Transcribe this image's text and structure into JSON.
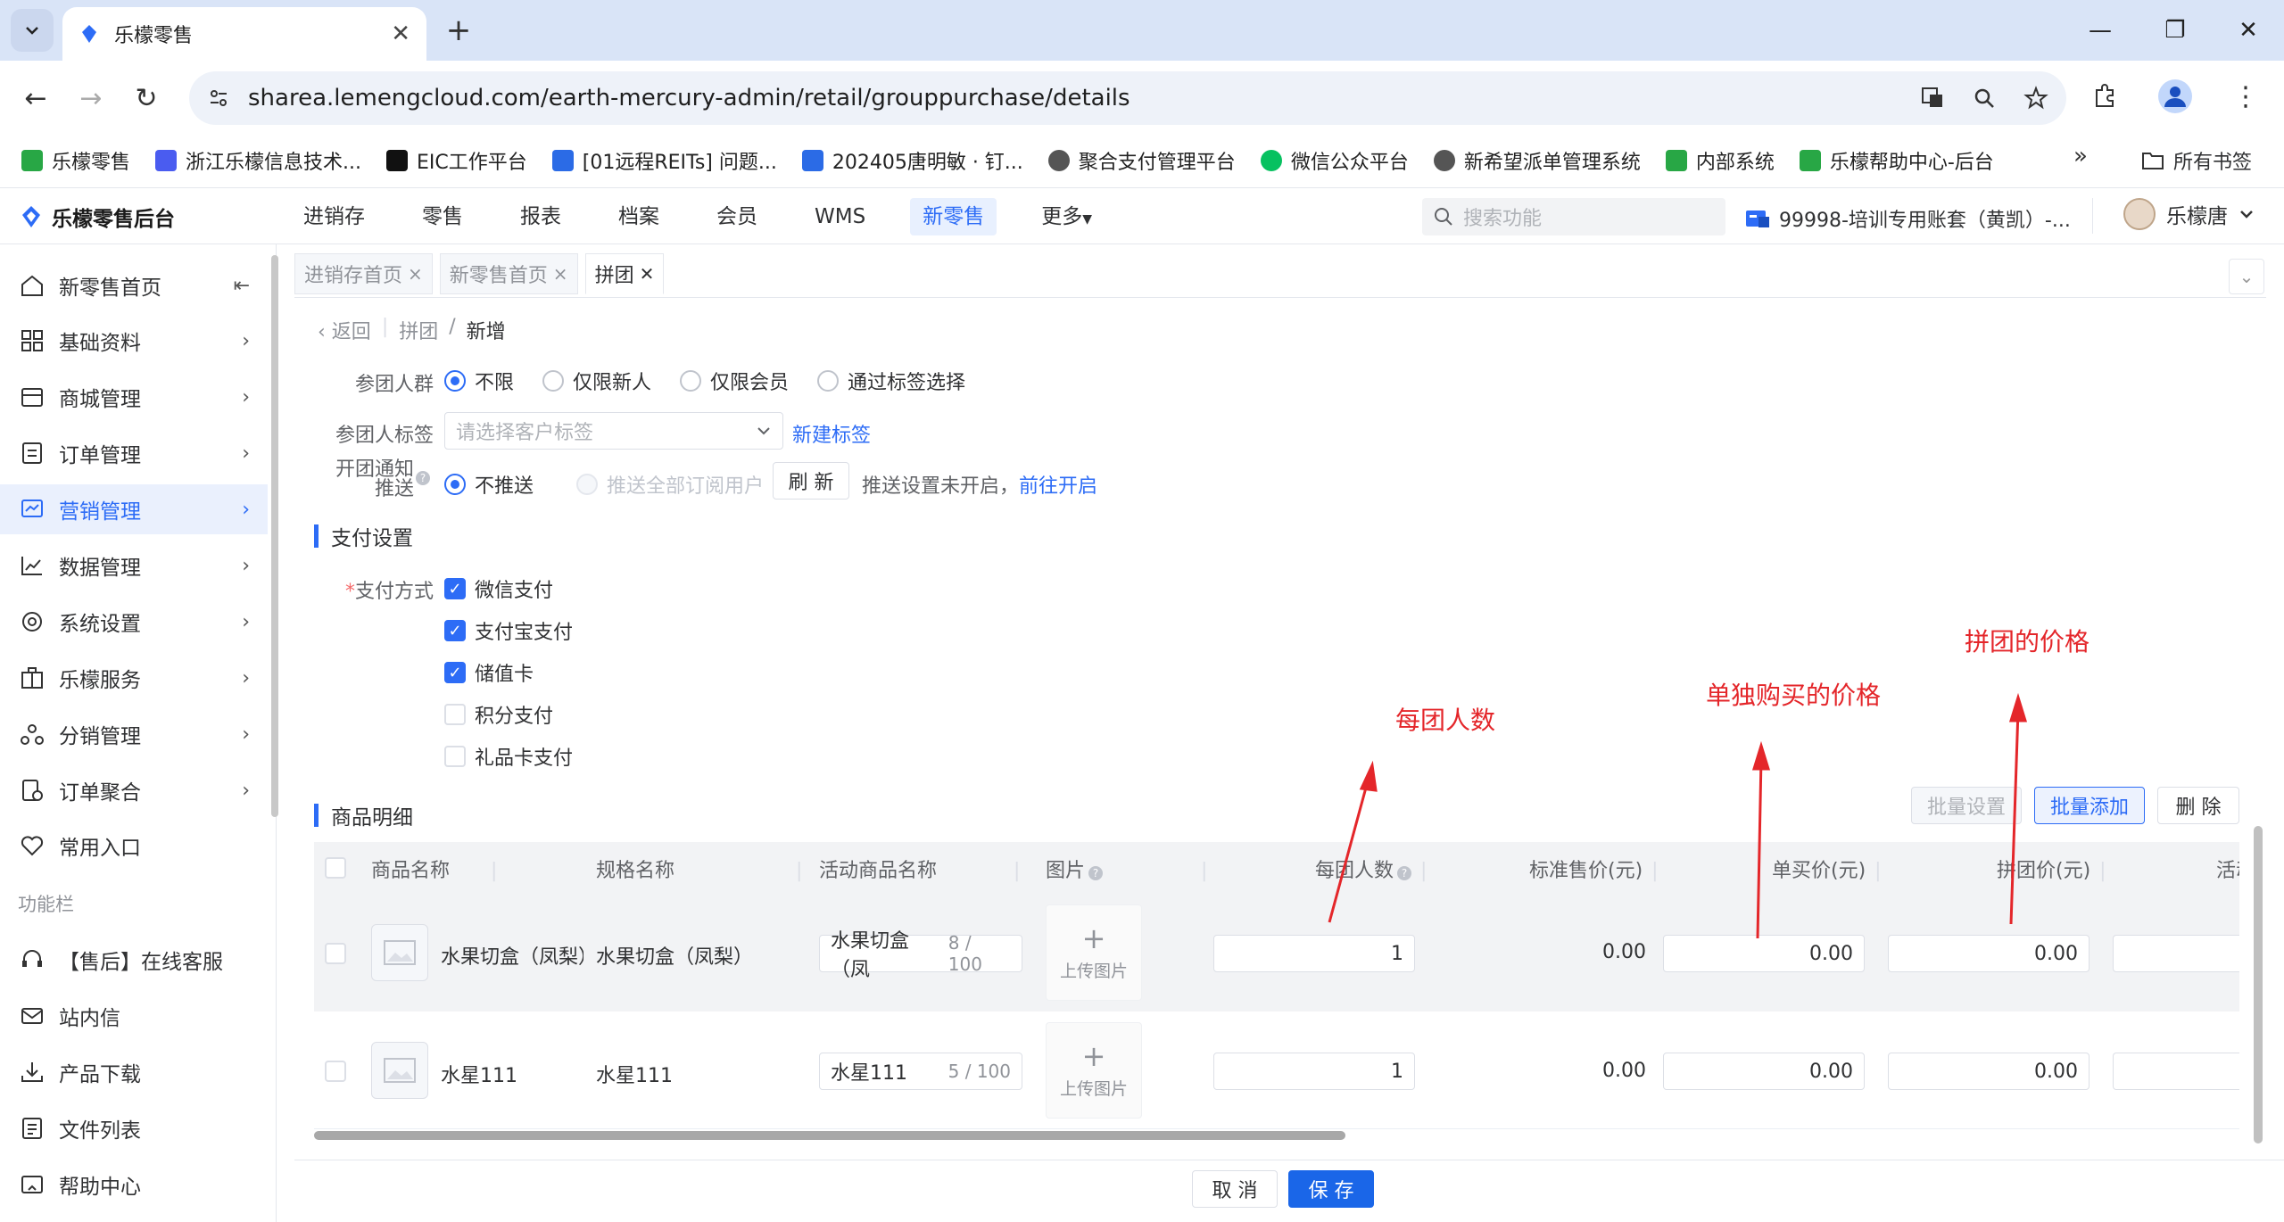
{
  "browser": {
    "tab_title": "乐檬零售",
    "url": "sharea.lemengcloud.com/earth-mercury-admin/retail/grouppurchase/details",
    "bookmarks": [
      "乐檬零售",
      "浙江乐檬信息技术...",
      "EIC工作平台",
      "[01远程REITs] 问题...",
      "202405唐明敏 · 钉...",
      "聚合支付管理平台",
      "微信公众平台",
      "新希望派单管理系统",
      "内部系统",
      "乐檬帮助中心-后台"
    ],
    "bookmarks_more": "所有书签",
    "bookmark_colors": [
      "#28a745",
      "#4a5cf0",
      "#111111",
      "#2b6be6",
      "#2b6be6",
      "#555555",
      "#07c160",
      "#555555",
      "#28a745",
      "#28a745"
    ]
  },
  "app": {
    "logo_text": "乐檬零售后台",
    "nav": [
      "进销存",
      "零售",
      "报表",
      "档案",
      "会员",
      "WMS",
      "新零售",
      "更多"
    ],
    "nav_active_index": 6,
    "search_placeholder": "搜索功能",
    "account": "99998-培训专用账套（黄凯）-...",
    "user_name": "乐檬唐"
  },
  "sidebar": {
    "items": [
      {
        "label": "新零售首页",
        "icon": "home-icon"
      },
      {
        "label": "基础资料",
        "icon": "grid-icon"
      },
      {
        "label": "商城管理",
        "icon": "store-icon"
      },
      {
        "label": "订单管理",
        "icon": "order-icon"
      },
      {
        "label": "营销管理",
        "icon": "marketing-icon"
      },
      {
        "label": "数据管理",
        "icon": "chart-icon"
      },
      {
        "label": "系统设置",
        "icon": "settings-icon"
      },
      {
        "label": "乐檬服务",
        "icon": "service-icon"
      },
      {
        "label": "分销管理",
        "icon": "distribution-icon"
      },
      {
        "label": "订单聚合",
        "icon": "aggregate-icon"
      },
      {
        "label": "常用入口",
        "icon": "heart-icon"
      }
    ],
    "active_index": 4,
    "section_label": "功能栏",
    "func_items": [
      {
        "label": "【售后】在线客服",
        "icon": "headset-icon"
      },
      {
        "label": "站内信",
        "icon": "mail-icon"
      },
      {
        "label": "产品下载",
        "icon": "download-icon"
      },
      {
        "label": "文件列表",
        "icon": "file-list-icon"
      },
      {
        "label": "帮助中心",
        "icon": "help-icon"
      }
    ]
  },
  "page_tabs": [
    {
      "label": "进销存首页",
      "active": false
    },
    {
      "label": "新零售首页",
      "active": false
    },
    {
      "label": "拼团",
      "active": true
    }
  ],
  "breadcrumb": {
    "back": "返回",
    "parent": "拼团",
    "sep": "/",
    "current": "新增"
  },
  "form": {
    "crowd_label": "参团人群",
    "crowd_options": [
      "不限",
      "仅限新人",
      "仅限会员",
      "通过标签选择"
    ],
    "crowd_selected": 0,
    "tag_label": "参团人标签",
    "tag_placeholder": "请选择客户标签",
    "tag_new_link": "新建标签",
    "notify_label_1": "开团通知",
    "notify_label_2": "推送",
    "notify_options": [
      "不推送",
      "推送全部订阅用户"
    ],
    "notify_selected": 0,
    "refresh_btn": "刷 新",
    "notify_hint": "推送设置未开启，",
    "notify_link": "前往开启"
  },
  "payment": {
    "section_title": "支付设置",
    "label": "支付方式",
    "methods": [
      {
        "label": "微信支付",
        "checked": true
      },
      {
        "label": "支付宝支付",
        "checked": true
      },
      {
        "label": "储值卡",
        "checked": true
      },
      {
        "label": "积分支付",
        "checked": false
      },
      {
        "label": "礼品卡支付",
        "checked": false
      }
    ]
  },
  "goods": {
    "section_title": "商品明细",
    "batch_set": "批量设置",
    "batch_add": "批量添加",
    "delete": "删 除",
    "columns": [
      "商品名称",
      "规格名称",
      "活动商品名称",
      "图片",
      "每团人数",
      "标准售价(元)",
      "单买价(元)",
      "拼团价(元)",
      "活动"
    ],
    "upload_text": "上传图片",
    "rows": [
      {
        "name": "水果切盒（凤梨）",
        "spec": "水果切盒（凤梨）",
        "activity_name": "水果切盒（凤",
        "count": "8 / 100",
        "group_size": "1",
        "std_price": "0.00",
        "single_price": "0.00",
        "group_price": "0.00"
      },
      {
        "name": "水星111",
        "spec": "水星111",
        "activity_name": "水星111",
        "count": "5 / 100",
        "group_size": "1",
        "std_price": "0.00",
        "single_price": "0.00",
        "group_price": "0.00"
      }
    ]
  },
  "annotations": {
    "group_size": "每团人数",
    "single_price": "单独购买的价格",
    "group_price": "拼团的价格"
  },
  "footer": {
    "cancel": "取 消",
    "save": "保 存"
  },
  "colors": {
    "primary": "#2d6cf6",
    "annotation": "#e4262a",
    "tab_strip": "#d9e4f7"
  }
}
